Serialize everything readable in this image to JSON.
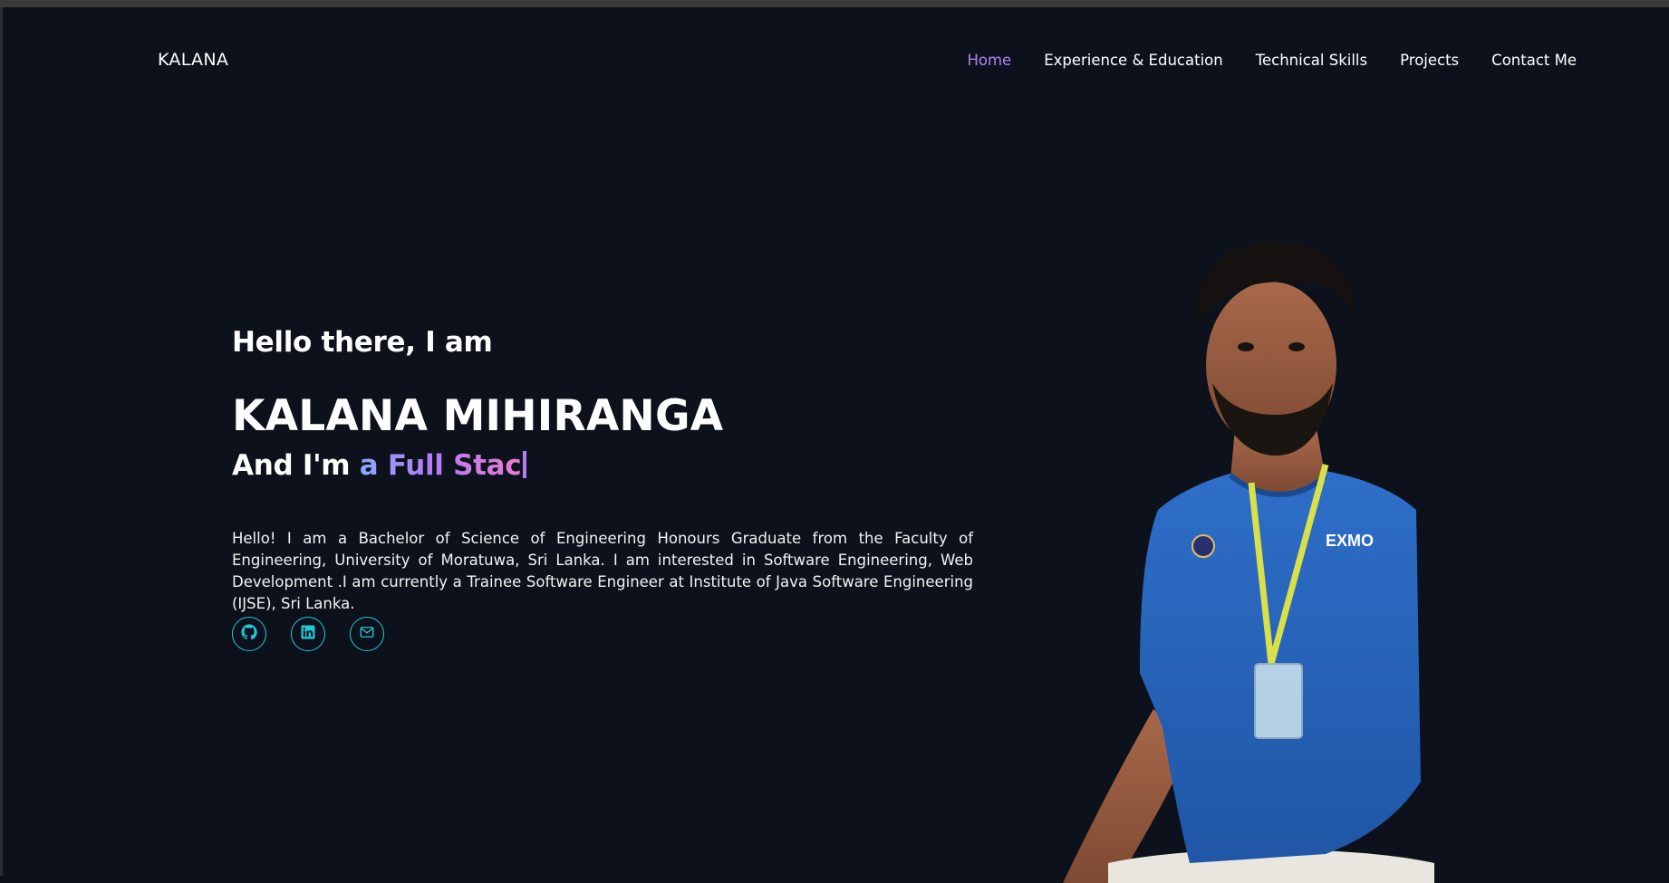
{
  "brand": "KALANA",
  "nav": {
    "items": [
      {
        "label": "Home",
        "active": true
      },
      {
        "label": "Experience & Education",
        "active": false
      },
      {
        "label": "Technical Skills",
        "active": false
      },
      {
        "label": "Projects",
        "active": false
      },
      {
        "label": "Contact Me",
        "active": false
      }
    ]
  },
  "hero": {
    "greeting": "Hello there, I am",
    "name": "KALANA MIHIRANGA",
    "role_prefix": "And I'm ",
    "role_typed": "a Full Stac",
    "bio": "Hello! I am a Bachelor of Science of Engineering Honours Graduate from the Faculty of Engineering, University of Moratuwa, Sri Lanka. I am interested in Software Engineering, Web Development .I am currently a Trainee Software Engineer at Institute of Java Software Engineering (IJSE), Sri Lanka."
  },
  "socials": [
    {
      "icon": "github-icon"
    },
    {
      "icon": "linkedin-icon"
    },
    {
      "icon": "mail-icon"
    }
  ],
  "portrait": {
    "shirt_text": "EXMO"
  },
  "colors": {
    "background": "#0c111c",
    "accent_nav": "#b083f5",
    "accent_social": "#22c7d9",
    "gradient_start": "#8aa8ff",
    "gradient_end": "#ea7bd0"
  }
}
